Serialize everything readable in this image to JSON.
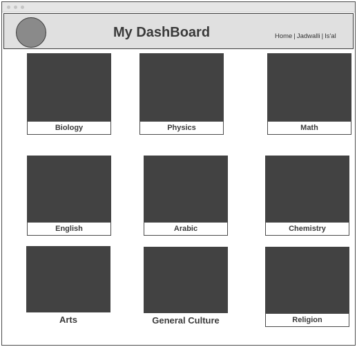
{
  "header": {
    "title": "My DashBoard",
    "nav": [
      {
        "label": "Home"
      },
      {
        "label": "Jadwalli"
      },
      {
        "label": "Is'al"
      }
    ],
    "nav_separator": "|"
  },
  "subjects": [
    {
      "label": "Biology"
    },
    {
      "label": "Physics"
    },
    {
      "label": "Math"
    },
    {
      "label": "English"
    },
    {
      "label": "Arabic"
    },
    {
      "label": "Chemistry"
    },
    {
      "label": "Arts"
    },
    {
      "label": "General Culture"
    },
    {
      "label": "Religion"
    }
  ],
  "colors": {
    "thumbnail": "#424242",
    "header_bg": "#e0e0e0",
    "avatar": "#8a8a8a"
  }
}
